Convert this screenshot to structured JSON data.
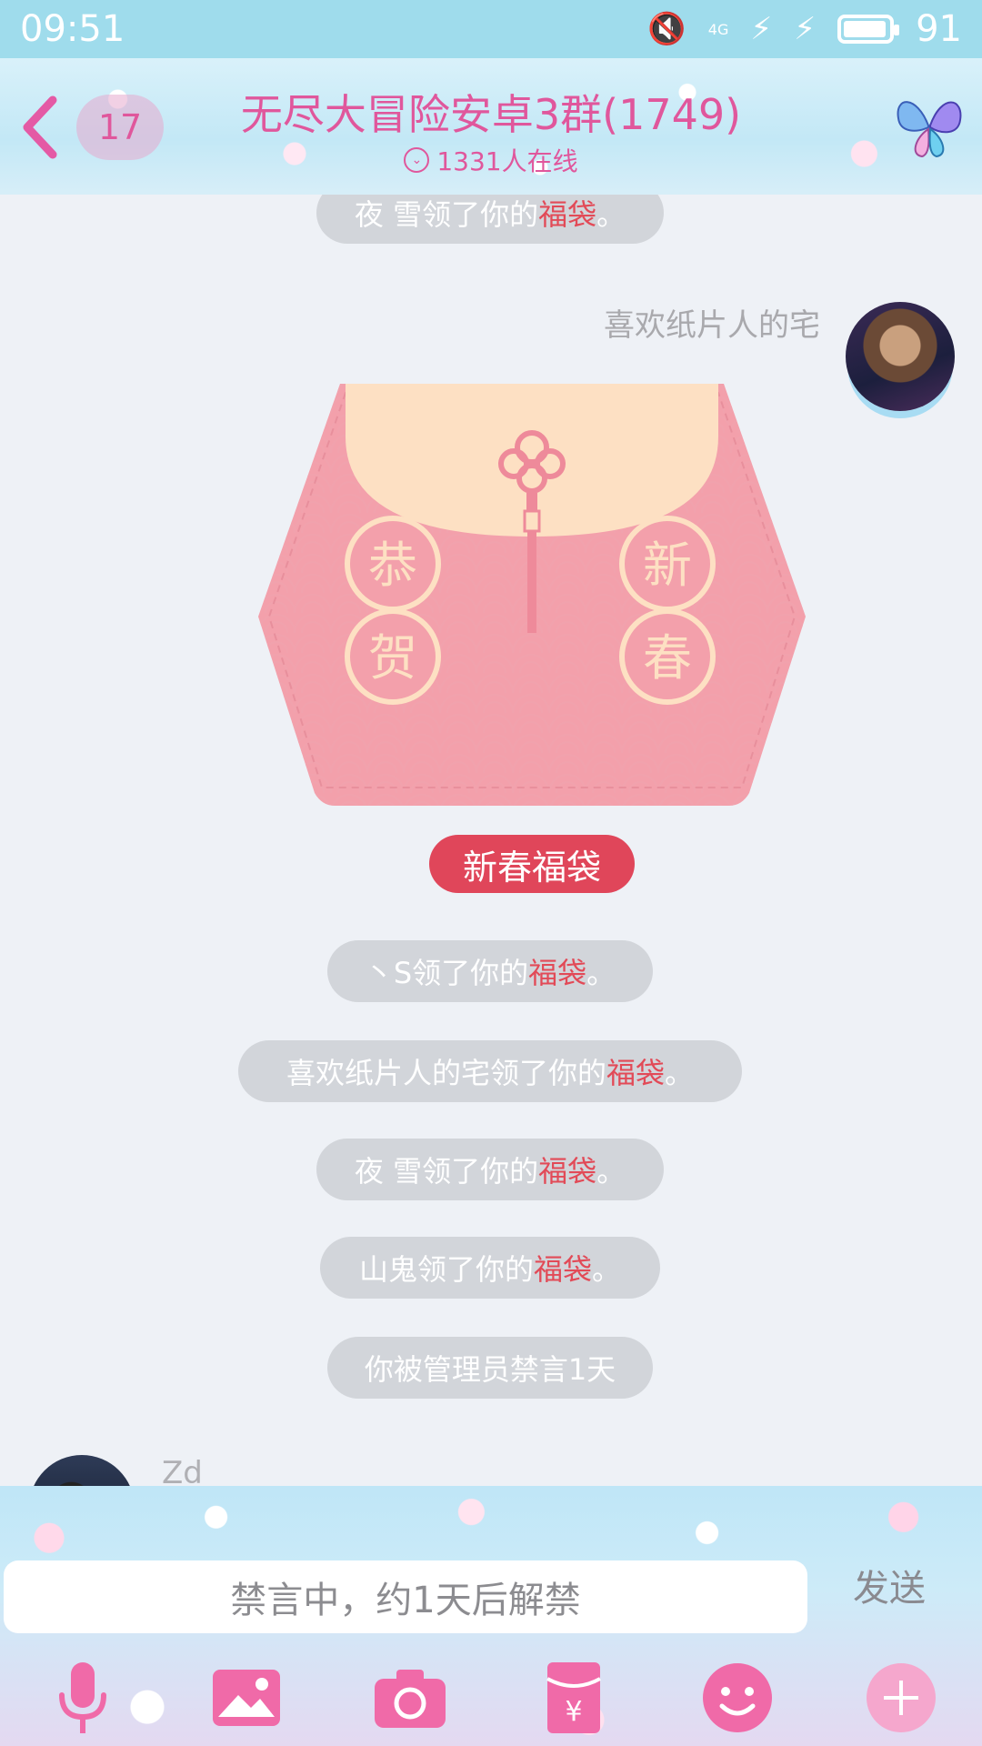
{
  "status_bar": {
    "time": "09:51",
    "network": "4G",
    "battery": "91",
    "battery_fraction": 0.91
  },
  "header": {
    "unread_count": "17",
    "title": "无尽大冒险安卓3群(1749)",
    "online": "1331人在线"
  },
  "messages": {
    "top_notice": {
      "prefix": "夜 雪领了你的",
      "highlight": "福袋",
      "suffix": "。"
    },
    "sender_name": "喜欢纸片人的宅",
    "pouch": {
      "left_chars": [
        "恭",
        "贺"
      ],
      "right_chars": [
        "新",
        "春"
      ],
      "label": "新春福袋"
    },
    "notices": [
      {
        "prefix": "丶S领了你的",
        "highlight": "福袋",
        "suffix": "。"
      },
      {
        "prefix": "喜欢纸片人的宅领了你的",
        "highlight": "福袋",
        "suffix": "。"
      },
      {
        "prefix": "夜 雪领了你的",
        "highlight": "福袋",
        "suffix": "。"
      },
      {
        "prefix": "山鬼领了你的",
        "highlight": "福袋",
        "suffix": "。"
      }
    ],
    "mute_notice": "你被管理员禁言1天",
    "next_sender": "Zd"
  },
  "input": {
    "placeholder": "禁言中，约1天后解禁",
    "send_label": "发送"
  },
  "toolbar_icons": [
    "microphone-icon",
    "image-icon",
    "camera-icon",
    "red-packet-icon",
    "emoji-icon",
    "plus-icon"
  ],
  "colors": {
    "accent_pink": "#e0579c",
    "highlight_red": "#e24a57",
    "pouch_label": "#e0465a"
  }
}
